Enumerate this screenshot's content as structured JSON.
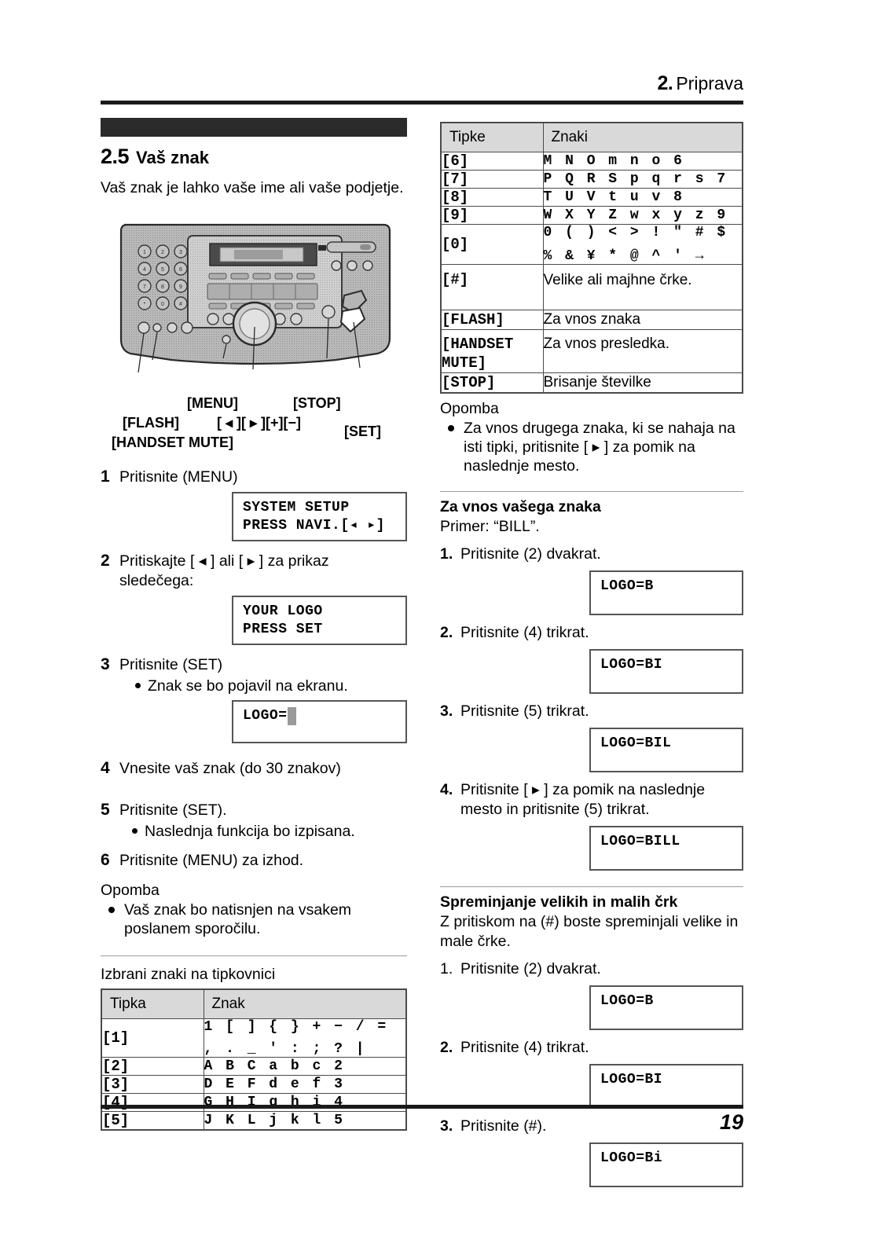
{
  "header": {
    "chapter_num": "2.",
    "chapter_title": "Priprava"
  },
  "footer": {
    "page_number": "19"
  },
  "section": {
    "number": "2.5",
    "title": "Vaš znak",
    "intro": "Vaš znak je lahko vaše ime ali vaše podjetje."
  },
  "figure": {
    "labels": {
      "menu": "[MENU]",
      "stop": "[STOP]",
      "flash": "[FLASH]",
      "navi": "[ ◂ ][ ▸ ][+][−]",
      "set": "[SET]",
      "handset_mute": "[HANDSET MUTE]"
    }
  },
  "steps": [
    {
      "n": "1",
      "text": "Pritisnite (MENU)",
      "lcd": [
        "SYSTEM SETUP",
        "PRESS NAVI.[◂  ▸]"
      ]
    },
    {
      "n": "2",
      "text": "Pritiskajte [ ◂ ] ali [ ▸ ] za prikaz sledečega:",
      "lcd": [
        "YOUR LOGO",
        "PRESS SET"
      ]
    },
    {
      "n": "3",
      "text": "Pritisnite (SET)",
      "sub": "Znak se bo pojavil na ekranu.",
      "lcd_prefix": "LOGO=",
      "lcd_cursor": true
    },
    {
      "n": "4",
      "text": "Vnesite vaš znak (do 30 znakov)"
    },
    {
      "n": "5",
      "text": "Pritisnite (SET).",
      "sub": "Naslednja funkcija bo izpisana."
    },
    {
      "n": "6",
      "text": "Pritisnite (MENU) za izhod."
    }
  ],
  "left_note": {
    "heading": "Opomba",
    "item": "Vaš znak bo natisnjen na vsakem poslanem sporočilu."
  },
  "left_table": {
    "caption": "Izbrani znaki na tipkovnici",
    "headers": [
      "Tipka",
      "Znak"
    ],
    "rows": [
      {
        "key": "[1]",
        "chars": "1 [ ] { } + − / =",
        "chars2": ", . _ ' : ; ? |"
      },
      {
        "key": "[2]",
        "chars": "A B C a b c 2"
      },
      {
        "key": "[3]",
        "chars": "D E F d e f 3"
      },
      {
        "key": "[4]",
        "chars": "G H I g h i 4"
      },
      {
        "key": "[5]",
        "chars": "J K L j k l 5"
      }
    ]
  },
  "right_table": {
    "headers": [
      "Tipke",
      "Znaki"
    ],
    "rows": [
      {
        "key": "[6]",
        "chars": "M N O m n o 6"
      },
      {
        "key": "[7]",
        "chars": "P Q R S p q r s 7"
      },
      {
        "key": "[8]",
        "chars": "T U V t u v 8"
      },
      {
        "key": "[9]",
        "chars": "W X Y Z w x y z 9"
      },
      {
        "key": "[0]",
        "chars": "0 ( ) < > ! \" # $",
        "chars2": "% & ¥ * @ ^ ' →"
      },
      {
        "key": "[#]",
        "desc": "Velike ali majhne črke."
      },
      {
        "key": "[FLASH]",
        "desc": "Za vnos znaka"
      },
      {
        "key": "[HANDSET MUTE]",
        "desc": "Za vnos presledka."
      },
      {
        "key": "[STOP]",
        "desc": "Brisanje številke"
      }
    ]
  },
  "right_note": {
    "heading": "Opomba",
    "item": "Za vnos drugega znaka, ki se nahaja na isti tipki, pritisnite [ ▸ ] za pomik na naslednje mesto."
  },
  "entry_section": {
    "heading": "Za vnos vašega znaka",
    "example": "Primer: “BILL”.",
    "steps": [
      {
        "n": "1.",
        "text": "Pritisnite (2) dvakrat.",
        "lcd": "LOGO=B"
      },
      {
        "n": "2.",
        "text": "Pritisnite (4) trikrat.",
        "lcd": "LOGO=BI"
      },
      {
        "n": "3.",
        "text": "Pritisnite (5) trikrat.",
        "lcd": "LOGO=BIL"
      },
      {
        "n": "4.",
        "text": "Pritisnite [ ▸ ] za pomik na naslednje mesto in pritisnite (5) trikrat.",
        "lcd": "LOGO=BILL"
      }
    ]
  },
  "case_section": {
    "heading": "Spreminjanje velikih in malih črk",
    "intro": "Z pritiskom na (#) boste spreminjali velike in male črke.",
    "steps": [
      {
        "n": "1.",
        "text": "Pritisnite (2) dvakrat.",
        "lcd": "LOGO=B"
      },
      {
        "n": "2.",
        "text": "Pritisnite (4) trikrat.",
        "lcd": "LOGO=BI"
      },
      {
        "n": "3.",
        "text": "Pritisnite (#).",
        "lcd": "LOGO=Bi"
      }
    ]
  }
}
